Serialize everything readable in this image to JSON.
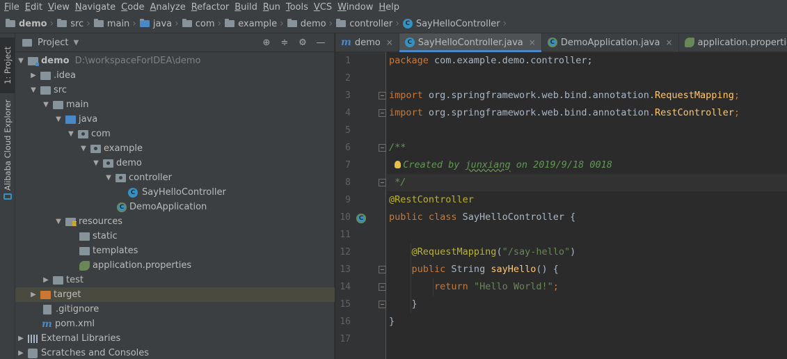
{
  "menu": [
    "File",
    "Edit",
    "View",
    "Navigate",
    "Code",
    "Analyze",
    "Refactor",
    "Build",
    "Run",
    "Tools",
    "VCS",
    "Window",
    "Help"
  ],
  "breadcrumbs": [
    "demo",
    "src",
    "main",
    "java",
    "com",
    "example",
    "demo",
    "controller",
    "SayHelloController"
  ],
  "sidebar": {
    "project_tab": "1: Project",
    "cloud_tab": "Alibaba Cloud Explorer"
  },
  "project": {
    "title": "Project",
    "root": {
      "label": "demo",
      "path": "D:\\workspaceForIDEA\\demo"
    },
    "tree": [
      "demo",
      ".idea",
      "src",
      "main",
      "java",
      "com",
      "example",
      "demo",
      "controller",
      "SayHelloController",
      "DemoApplication",
      "resources",
      "static",
      "templates",
      "application.properties",
      "test",
      "target",
      ".gitignore",
      "pom.xml",
      "External Libraries",
      "Scratches and Consoles"
    ]
  },
  "tabs": [
    "demo",
    "SayHelloController.java",
    "DemoApplication.java",
    "application.properties"
  ],
  "editor": {
    "line_numbers": [
      "1",
      "2",
      "3",
      "4",
      "5",
      "6",
      "7",
      "8",
      "9",
      "10",
      "11",
      "12",
      "13",
      "14",
      "15",
      "16",
      "17"
    ],
    "package_kw": "package",
    "package_name": " com.example.demo.controller;",
    "import_kw": "import",
    "import1_pkg": " org.springframework.web.bind.annotation.",
    "import1_cls": "RequestMapping",
    "import2_pkg": " org.springframework.web.bind.annotation.",
    "import2_cls": "RestController",
    "semi": ";",
    "doc_open": "/**",
    "doc_created": "Created by ",
    "doc_author": "junxiang",
    "doc_date": " on 2019/9/18 0018",
    "doc_close": " */",
    "ann_rest": "@RestController",
    "class_kw": "public class",
    "class_name": " SayHelloController {",
    "ann_map": "@RequestMapping",
    "map_open": "(",
    "map_str": "\"/say-hello\"",
    "map_close": ")",
    "method_kw": "public",
    "method_type": " String ",
    "method_name": "sayHello",
    "method_rest": "() {",
    "return_kw": "return",
    "return_str": " \"Hello World!\"",
    "close_method": "}",
    "close_class": "}"
  },
  "colors": {
    "keyword": "#cc7832",
    "annotation": "#bbb529",
    "string": "#6a8759",
    "doc": "#629755",
    "method": "#ffc66d"
  }
}
